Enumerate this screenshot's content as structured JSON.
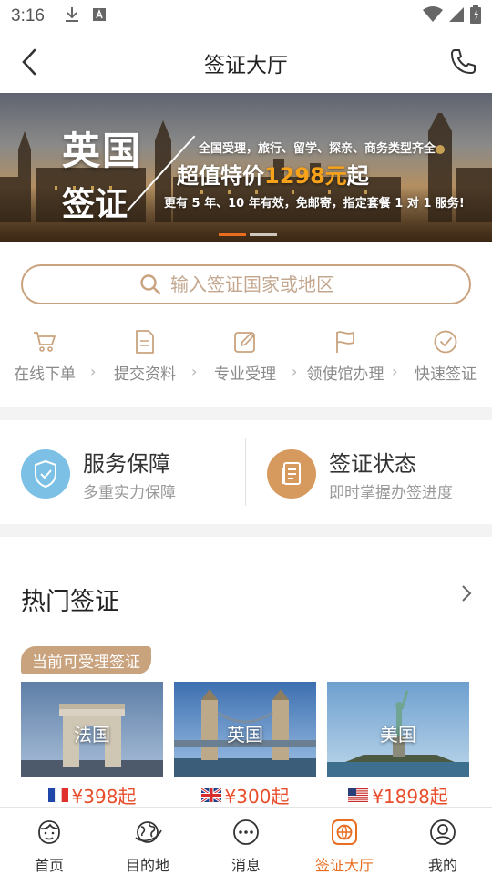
{
  "status_bar": {
    "time": "3:16"
  },
  "header": {
    "title": "签证大厅"
  },
  "banner": {
    "big_line1": "英国",
    "big_line2": "签证",
    "line1": "全国受理，旅行、留学、探亲、商务类型齐全",
    "line2_prefix": "超值特价",
    "line2_highlight": "1298元",
    "line2_suffix": "起",
    "line3": "更有 5 年、10 年有效，免邮寄，指定套餐 1 对 1 服务!",
    "active_slide": 1,
    "slide_count": 2
  },
  "search": {
    "placeholder": "输入签证国家或地区"
  },
  "steps": [
    {
      "label": "在线下单",
      "icon": "cart-icon"
    },
    {
      "label": "提交资料",
      "icon": "document-icon"
    },
    {
      "label": "专业受理",
      "icon": "edit-icon"
    },
    {
      "label": "领使馆办理",
      "icon": "flag-icon"
    },
    {
      "label": "快速签证",
      "icon": "check-circle-icon"
    }
  ],
  "services": [
    {
      "title": "服务保障",
      "subtitle": "多重实力保障",
      "icon": "shield-icon",
      "color": "#5aaee0"
    },
    {
      "title": "签证状态",
      "subtitle": "即时掌握办签进度",
      "icon": "document-list-icon",
      "color": "#d69a5e"
    }
  ],
  "hot_visa": {
    "title": "热门签证",
    "badge": "当前可受理签证",
    "cards": [
      {
        "country": "法国",
        "price": "¥398起",
        "flag": "france-flag-icon"
      },
      {
        "country": "英国",
        "price": "¥300起",
        "flag": "uk-flag-icon"
      },
      {
        "country": "美国",
        "price": "¥1898起",
        "flag": "usa-flag-icon"
      }
    ]
  },
  "tabs": [
    {
      "label": "首页",
      "icon": "home-face-icon",
      "active": false
    },
    {
      "label": "目的地",
      "icon": "globe-icon",
      "active": false
    },
    {
      "label": "消息",
      "icon": "message-icon",
      "active": false
    },
    {
      "label": "签证大厅",
      "icon": "visa-icon",
      "active": true
    },
    {
      "label": "我的",
      "icon": "user-icon",
      "active": false
    }
  ],
  "colors": {
    "accent": "#e86d1f",
    "gold": "#c9a27e",
    "price": "#e84e2b"
  }
}
